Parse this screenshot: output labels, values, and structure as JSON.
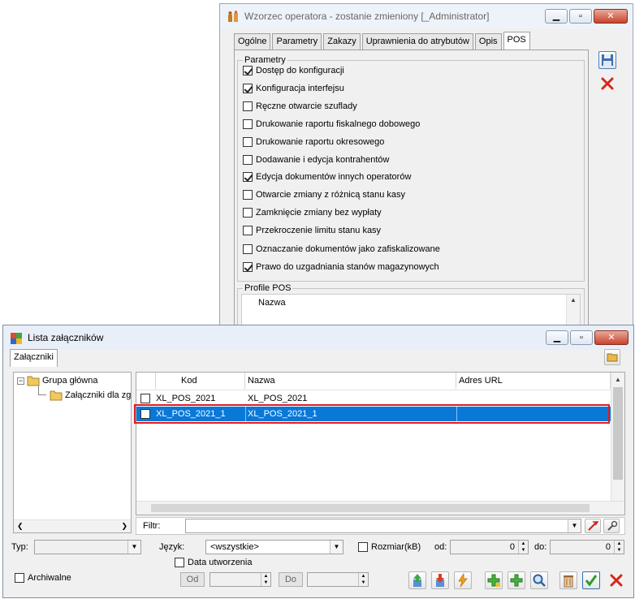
{
  "operator_window": {
    "title": "Wzorzec operatora - zostanie zmieniony [_Administrator]",
    "tabs": [
      "Ogólne",
      "Parametry",
      "Zakazy",
      "Uprawnienia do atrybutów",
      "Opis",
      "POS"
    ],
    "active_tab": "POS",
    "params_group_title": "Parametry",
    "params": [
      {
        "label": "Dostęp do konfiguracji",
        "checked": true
      },
      {
        "label": "Konfiguracja interfejsu",
        "checked": true
      },
      {
        "label": "Ręczne otwarcie szuflady",
        "checked": false
      },
      {
        "label": "Drukowanie raportu fiskalnego dobowego",
        "checked": false
      },
      {
        "label": "Drukowanie raportu okresowego",
        "checked": false
      },
      {
        "label": "Dodawanie i edycja kontrahentów",
        "checked": false
      },
      {
        "label": "Edycja dokumentów innych operatorów",
        "checked": true
      },
      {
        "label": "Otwarcie zmiany z różnicą stanu kasy",
        "checked": false
      },
      {
        "label": "Zamknięcie zmiany bez wypłaty",
        "checked": false
      },
      {
        "label": "Przekroczenie limitu stanu kasy",
        "checked": false
      },
      {
        "label": "Oznaczanie dokumentów jako zafiskalizowane",
        "checked": false
      },
      {
        "label": "Prawo do uzgadniania stanów magazynowych",
        "checked": true
      }
    ],
    "profile_group_title": "Profile POS",
    "profile_column": "Nazwa"
  },
  "attachments_window": {
    "title": "Lista załączników",
    "tab": "Załączniki",
    "tree": {
      "root": "Grupa główna",
      "child": "Załączniki dla zg"
    },
    "columns": [
      "Kod",
      "Nazwa",
      "Adres URL"
    ],
    "rows": [
      {
        "kod": "XL_POS_2021",
        "nazwa": "XL_POS_2021",
        "url": "",
        "selected": false
      },
      {
        "kod": "XL_POS_2021_1",
        "nazwa": "XL_POS_2021_1",
        "url": "",
        "selected": true
      }
    ],
    "filter_label": "Filtr:",
    "typ_label": "Typ:",
    "jezyk_label": "Język:",
    "jezyk_value": "<wszystkie>",
    "rozmiar_label": "Rozmiar(kB)",
    "od_label": "od:",
    "od_value": "0",
    "do_label": "do:",
    "do_value": "0",
    "data_utworzenia_label": "Data utworzenia",
    "archiwalne_label": "Archiwalne",
    "od_button": "Od",
    "do_button": "Do"
  },
  "colors": {
    "selection": "#0a78d7",
    "highlight_border": "#e01b24",
    "accent": "#2f6fb5"
  }
}
